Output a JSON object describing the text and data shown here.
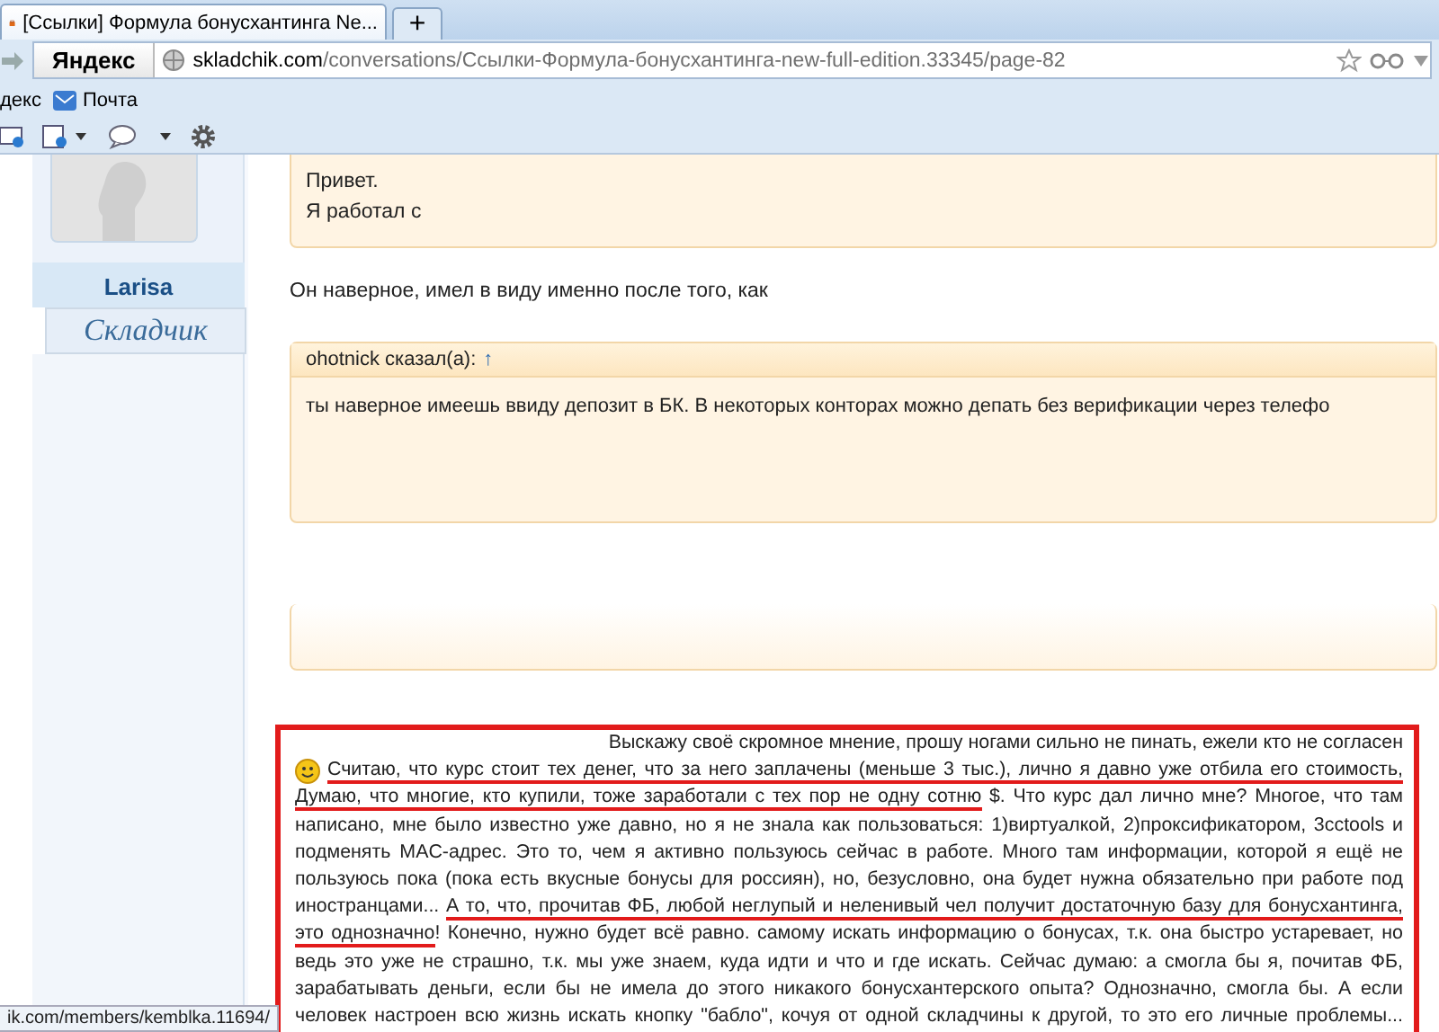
{
  "browser": {
    "tab_title": "[Ссылки] Формула бонусхантинга Ne...",
    "new_tab": "+",
    "logo": "Яндекс",
    "url_host": "skladchik.com",
    "url_path": "/conversations/Ссылки-Формула-бонусхантинга-new-full-edition.33345/page-82",
    "bookmarks": [
      {
        "label": "декс"
      },
      {
        "label": "Почта"
      }
    ]
  },
  "user": {
    "name": "Larisa",
    "role": "Складчик"
  },
  "quote_top": {
    "lines": [
      "Привет.",
      "Я работал с"
    ]
  },
  "reply_text": "Он наверное, имел в виду именно после того, как",
  "quote": {
    "author": "ohotnick сказал(а):",
    "link": "↑",
    "text": "ты наверное имеешь ввиду депозит в БК. В некоторых конторах можно депать без верификации через телефо"
  },
  "highlighted_post": {
    "lines": [
      [
        {
          "text": "Выскажу своё скромное мнение, прошу ногами сильно не пинать, ежели кто не согласен",
          "underlined": false
        }
      ],
      [
        {
          "text": "Считаю, что курс стоит тех денег, что за него заплачены (меньше 3 тыс.), лично я давно уже отбила его стоимость,",
          "underlined": true
        }
      ],
      [
        {
          "text": "Думаю, что многие, кто купили, тоже заработали с тех пор не одну сотню",
          "underlined": true
        },
        {
          "text": " $. Что курс дал лично мне? Многое, что там",
          "underlined": false
        }
      ],
      [
        {
          "text": "написано, мне было известно уже давно, но я не знала как пользоваться: 1)виртуалкой, 2)проксификатором, 3cctools и",
          "underlined": false
        }
      ],
      [
        {
          "text": "подменять MAC-адрес. Это то, чем я активно пользуюсь сейчас в работе. Много там информации, которой я ещё не",
          "underlined": false
        }
      ],
      [
        {
          "text": "пользуюсь пока (пока есть вкусные бонусы для россиян), но, безусловно, она будет нужна обязательно при работе под",
          "underlined": false
        }
      ],
      [
        {
          "text": "иностранцами... ",
          "underlined": false
        },
        {
          "text": "А то, что, прочитав ФБ, любой неглупый и неленивый чел получит достаточную базу для бонусхантинга,",
          "underlined": true
        }
      ],
      [
        {
          "text": "это однозначно",
          "underlined": true
        },
        {
          "text": "! Конечно, нужно будет всё равно. самому искать информацию о бонусах, т.к. она быстро устаревает, но",
          "underlined": false
        }
      ],
      [
        {
          "text": "ведь это уже не страшно, т.к. мы уже знаем, куда идти и что и где искать. Сейчас думаю: а смогла бы я, почитав ФБ,",
          "underlined": false
        }
      ],
      [
        {
          "text": "зарабатывать деньги, если бы не имела до этого никакого бонусхантерского опыта? Однозначно, смогла бы. А если",
          "underlined": false
        }
      ],
      [
        {
          "text": "человек настроен всю жизнь искать кнопку \"бабло\", кочуя от одной складчины к другой, то это его личные проблемы...",
          "underlined": false
        }
      ]
    ]
  },
  "status_url": "ik.com/members/kemblka.11694/"
}
